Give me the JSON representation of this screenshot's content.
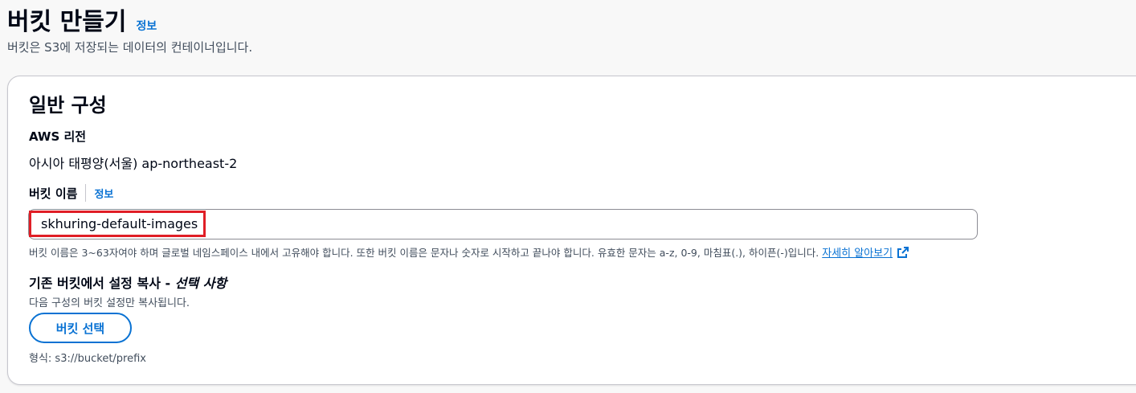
{
  "header": {
    "title": "버킷 만들기",
    "info_link": "정보",
    "description": "버킷은 S3에 저장되는 데이터의 컨테이너입니다."
  },
  "general_config": {
    "section_title": "일반 구성",
    "region": {
      "label": "AWS 리전",
      "value": "아시아 태평양(서울) ap-northeast-2"
    },
    "bucket_name": {
      "label": "버킷 이름",
      "info_link": "정보",
      "value": "skhuring-default-images",
      "constraint_text": "버킷 이름은 3~63자여야 하며 글로벌 네임스페이스 내에서 고유해야 합니다. 또한 버킷 이름은 문자나 숫자로 시작하고 끝나야 합니다. 유효한 문자는 a-z, 0-9, 마침표(.), 하이픈(-)입니다.",
      "learn_more_link": "자세히 알아보기",
      "learn_more_icon": "external-link-icon"
    },
    "copy_settings": {
      "label_main": "기존 버킷에서 설정 복사 - ",
      "label_optional": "선택 사항",
      "description": "다음 구성의 버킷 설정만 복사됩니다.",
      "button_label": "버킷 선택",
      "format_hint": "형식: s3://bucket/prefix"
    }
  },
  "colors": {
    "accent": "#0972d3",
    "highlight": "#e01e26",
    "text_primary": "#000716",
    "text_secondary": "#414d5c"
  }
}
